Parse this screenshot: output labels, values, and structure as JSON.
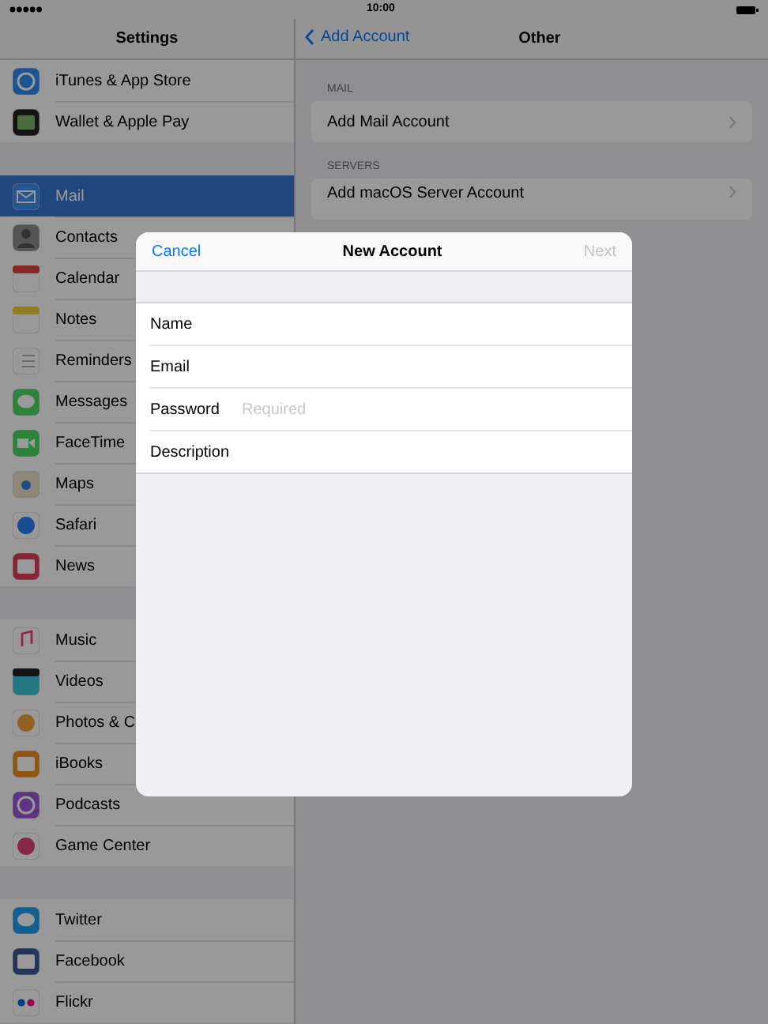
{
  "status_bar": {
    "time": "10:00"
  },
  "sidebar": {
    "title": "Settings",
    "groups": [
      {
        "items": [
          {
            "label": "iTunes & App Store",
            "selected": false
          },
          {
            "label": "Wallet & Apple Pay",
            "selected": false
          }
        ]
      },
      {
        "items": [
          {
            "label": "Mail",
            "selected": true
          },
          {
            "label": "Contacts",
            "selected": false
          },
          {
            "label": "Calendar",
            "selected": false
          },
          {
            "label": "Notes",
            "selected": false
          },
          {
            "label": "Reminders",
            "selected": false
          },
          {
            "label": "Messages",
            "selected": false
          },
          {
            "label": "FaceTime",
            "selected": false
          },
          {
            "label": "Maps",
            "selected": false
          },
          {
            "label": "Safari",
            "selected": false
          },
          {
            "label": "News",
            "selected": false
          }
        ]
      },
      {
        "items": [
          {
            "label": "Music",
            "selected": false
          },
          {
            "label": "Videos",
            "selected": false
          },
          {
            "label": "Photos & C",
            "selected": false
          },
          {
            "label": "iBooks",
            "selected": false
          },
          {
            "label": "Podcasts",
            "selected": false
          },
          {
            "label": "Game Center",
            "selected": false
          }
        ]
      },
      {
        "items": [
          {
            "label": "Twitter",
            "selected": false
          },
          {
            "label": "Facebook",
            "selected": false
          },
          {
            "label": "Flickr",
            "selected": false
          }
        ]
      }
    ]
  },
  "detail": {
    "back": "Add Account",
    "title": "Other",
    "sections": [
      {
        "header": "MAIL",
        "rows": [
          "Add Mail Account"
        ]
      },
      {
        "header": "SERVERS",
        "rows": [
          "Add macOS Server Account"
        ]
      }
    ]
  },
  "dialog": {
    "cancel": "Cancel",
    "title": "New Account",
    "next": {
      "label": "Next",
      "disabled": true
    },
    "fields": [
      {
        "label": "Name"
      },
      {
        "label": "Email"
      },
      {
        "label": "Password",
        "placeholder": "Required"
      },
      {
        "label": "Description"
      }
    ]
  }
}
